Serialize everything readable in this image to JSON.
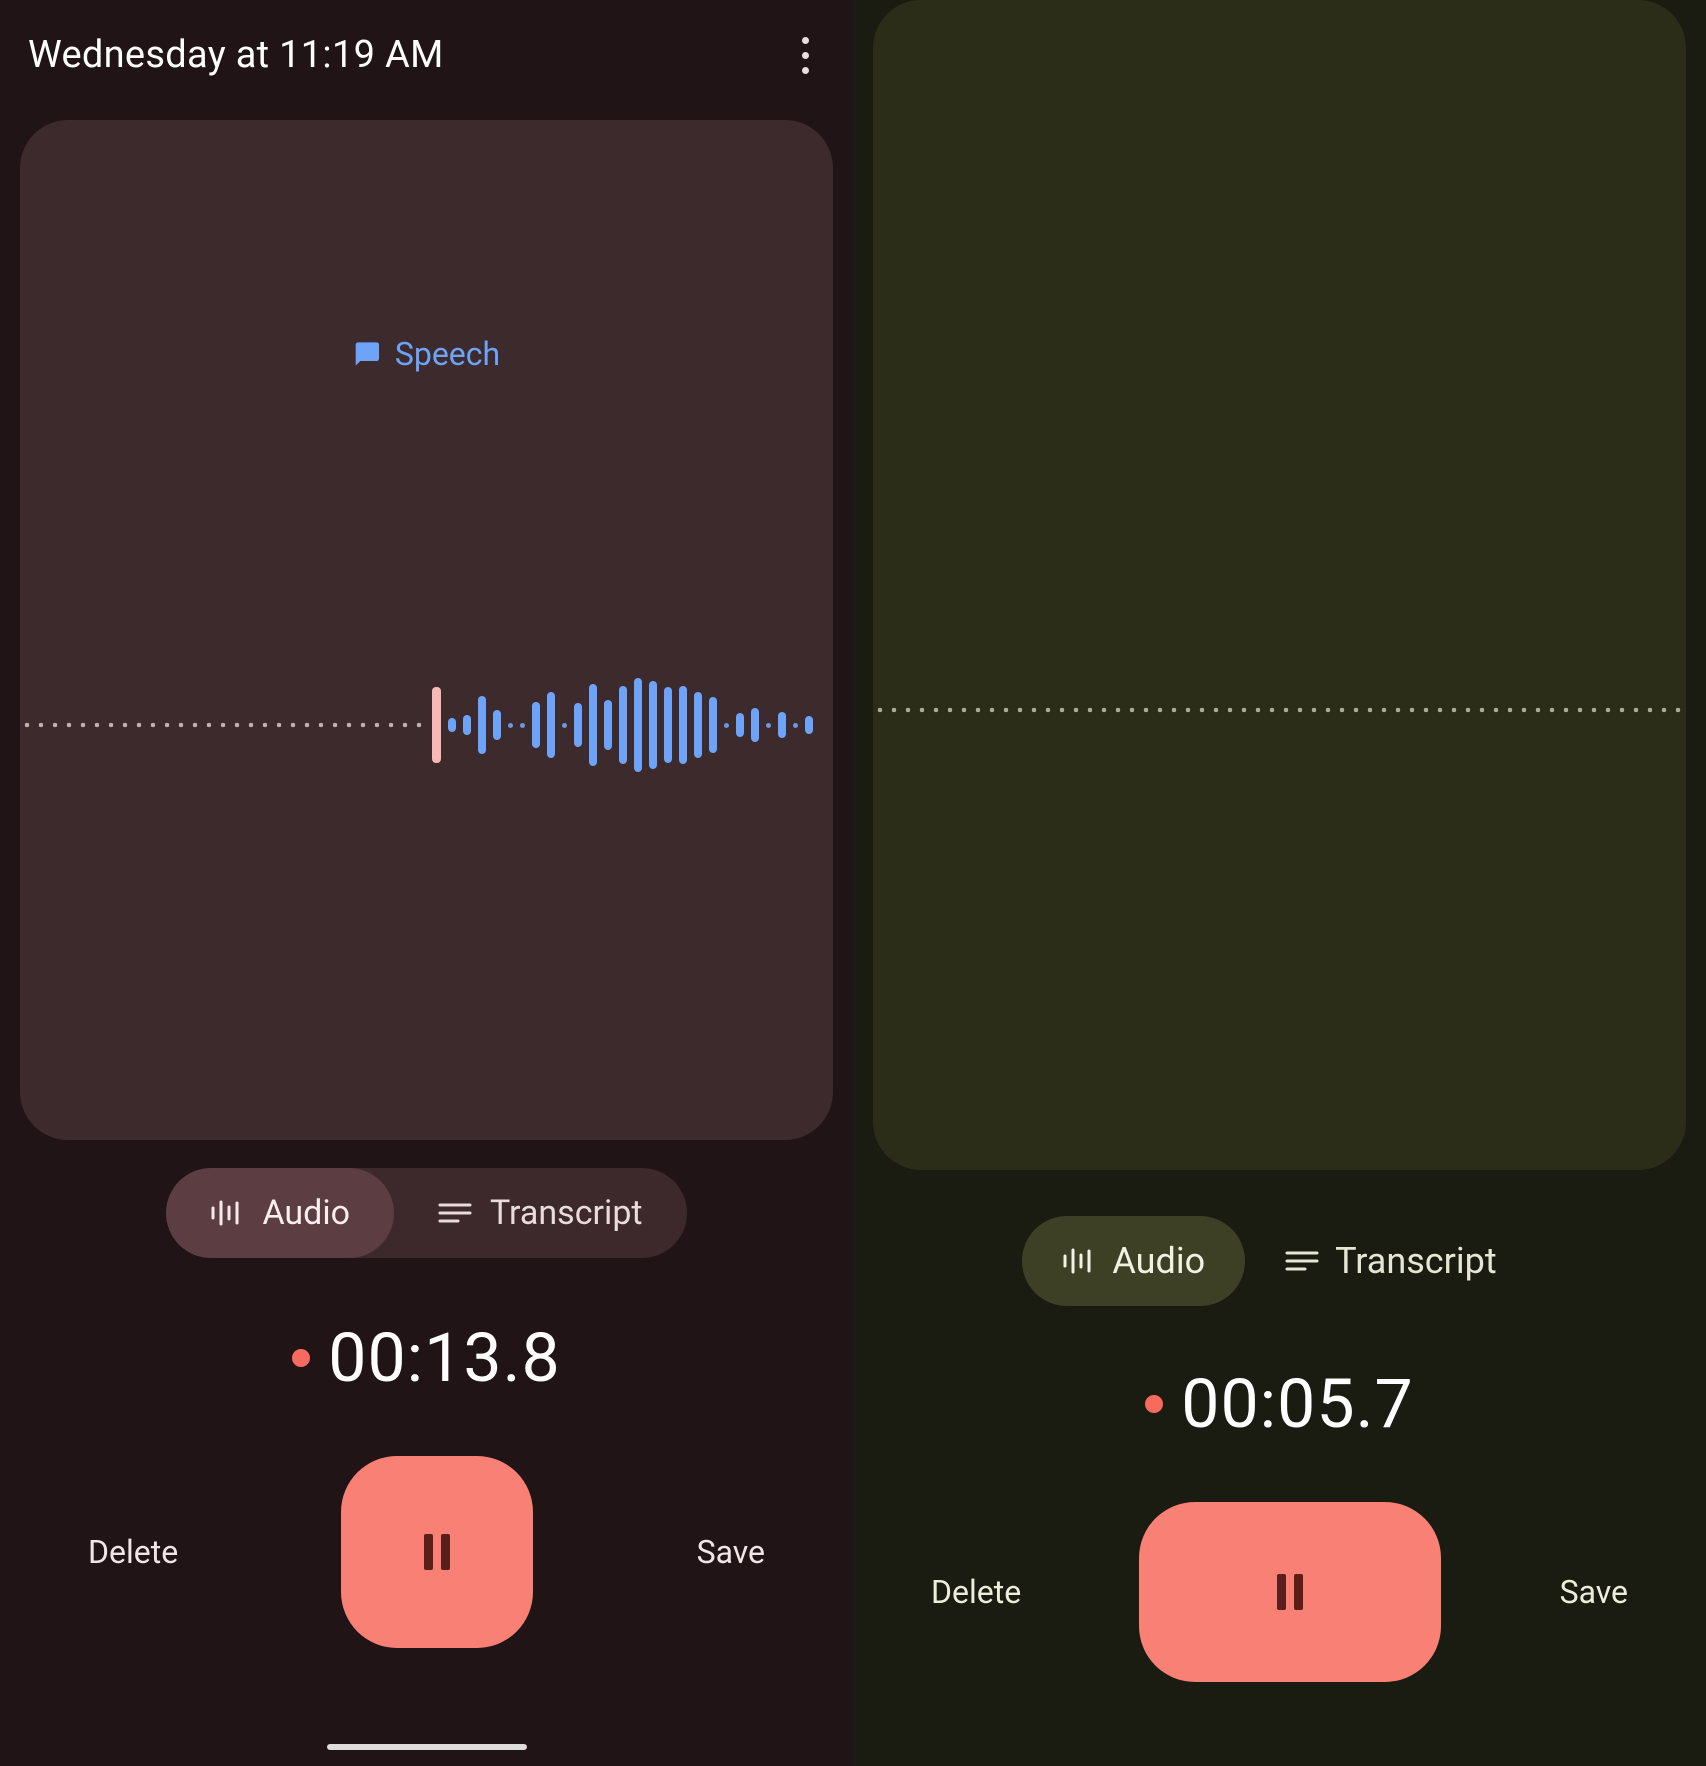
{
  "left": {
    "title": "Wednesday at 11:19 AM",
    "speech_label": "Speech",
    "tabs": {
      "audio": "Audio",
      "transcript": "Transcript"
    },
    "timer": "00:13.8",
    "delete": "Delete",
    "save": "Save",
    "wave_heights": [
      76,
      14,
      20,
      58,
      30,
      6,
      6,
      46,
      66,
      6,
      44,
      82,
      50,
      78,
      94,
      88,
      76,
      78,
      66,
      56,
      6,
      24,
      34,
      6,
      26,
      6,
      18
    ]
  },
  "right": {
    "tabs": {
      "audio": "Audio",
      "transcript": "Transcript"
    },
    "timer": "00:05.7",
    "delete": "Delete",
    "save": "Save"
  }
}
